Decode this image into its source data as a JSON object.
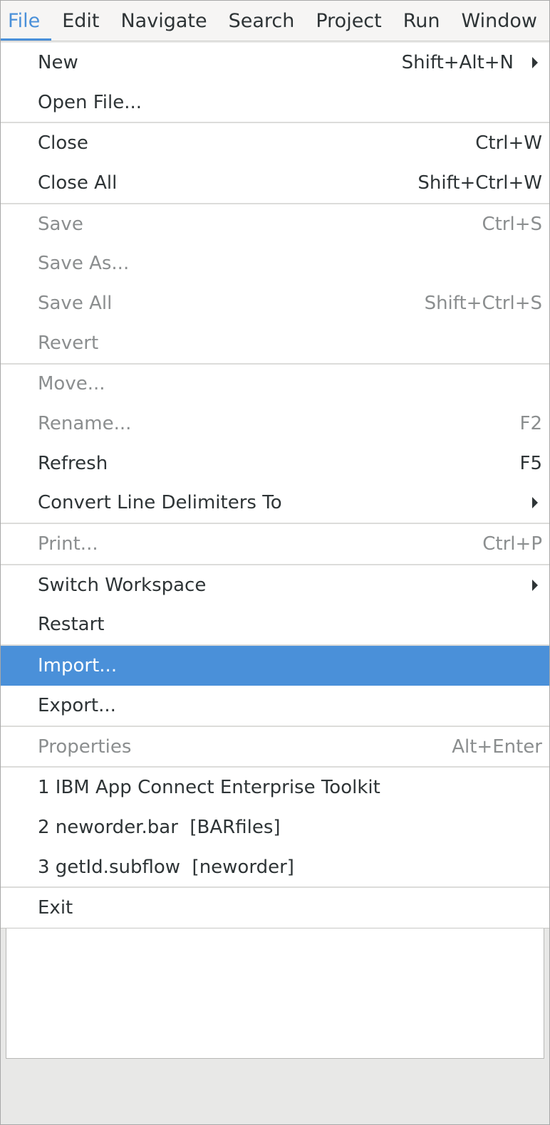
{
  "menubar": {
    "items": [
      "File",
      "Edit",
      "Navigate",
      "Search",
      "Project",
      "Run",
      "Window"
    ]
  },
  "file_menu": {
    "new": {
      "label": "New",
      "accel": "Shift+Alt+N"
    },
    "open_file": {
      "label": "Open File..."
    },
    "close": {
      "label": "Close",
      "accel": "Ctrl+W"
    },
    "close_all": {
      "label": "Close All",
      "accel": "Shift+Ctrl+W"
    },
    "save": {
      "label": "Save",
      "accel": "Ctrl+S"
    },
    "save_as": {
      "label": "Save As..."
    },
    "save_all": {
      "label": "Save All",
      "accel": "Shift+Ctrl+S"
    },
    "revert": {
      "label": "Revert"
    },
    "move": {
      "label": "Move..."
    },
    "rename": {
      "label": "Rename...",
      "accel": "F2"
    },
    "refresh": {
      "label": "Refresh",
      "accel": "F5"
    },
    "convert": {
      "label": "Convert Line Delimiters To"
    },
    "print": {
      "label": "Print...",
      "accel": "Ctrl+P"
    },
    "switch_workspace": {
      "label": "Switch Workspace"
    },
    "restart": {
      "label": "Restart"
    },
    "import": {
      "label": "Import..."
    },
    "export": {
      "label": "Export..."
    },
    "properties": {
      "label": "Properties",
      "accel": "Alt+Enter"
    },
    "recent": [
      "1 IBM App Connect Enterprise Toolkit",
      "2 neworder.bar  [BARfiles]",
      "3 getId.subflow  [neworder]"
    ],
    "exit": {
      "label": "Exit"
    }
  },
  "colors": {
    "selection": "#4a90d9",
    "disabled_text": "#8b8e8f",
    "menubar_active": "#4a90d9"
  }
}
